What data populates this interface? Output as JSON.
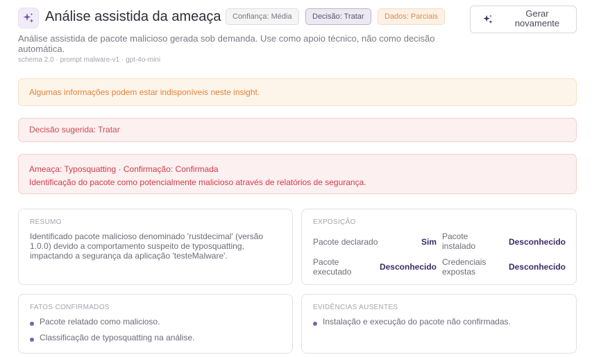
{
  "header": {
    "title": "Análise assistida da ameaça",
    "icon": "sparkles-icon",
    "badges": {
      "confidence": "Confiança: Média",
      "decision": "Decisão: Tratar",
      "data": "Dados: Parciais"
    },
    "regenerate_label": "Gerar novamente"
  },
  "description": "Análise assistida de pacote malicioso gerada sob demanda. Use como apoio técnico, não como decisão automática.",
  "meta": "schema 2.0 · prompt malware-v1 · gpt-4o-mini",
  "alerts": {
    "warning": "Algumas informações podem estar indisponíveis neste insight.",
    "decision": "Decisão sugerida: Tratar",
    "threat_line1": "Ameaça: Typosquatting · Confirmação: Confirmada",
    "threat_line2": "Identificação do pacote como potencialmente malicioso através de relatórios de segurança."
  },
  "summary": {
    "title": "RESUMO",
    "text": "Identificado pacote malicioso denominado 'rustdecimal' (versão 1.0.0) devido a comportamento suspeito de typosquatting, impactando a segurança da aplicação 'testeMalware'."
  },
  "exposure": {
    "title": "EXPOSIÇÃO",
    "items": [
      {
        "label": "Pacote declarado",
        "value": "Sim"
      },
      {
        "label": "Pacote instalado",
        "value": "Desconhecido"
      },
      {
        "label": "Pacote executado",
        "value": "Desconhecido"
      },
      {
        "label": "Credenciais expostas",
        "value": "Desconhecido"
      }
    ]
  },
  "confirmed_facts": {
    "title": "FATOS CONFIRMADOS",
    "items": [
      "Pacote relatado como malicioso.",
      "Classificação de typosquatting na análise."
    ]
  },
  "missing_evidence": {
    "title": "EVIDÊNCIAS AUSENTES",
    "items": [
      "Instalação e execução do pacote não confirmadas."
    ]
  },
  "colors": {
    "accent": "#7b64a6",
    "value_text": "#3b2d66",
    "warning": "#e0823c",
    "danger": "#cf3c47"
  }
}
